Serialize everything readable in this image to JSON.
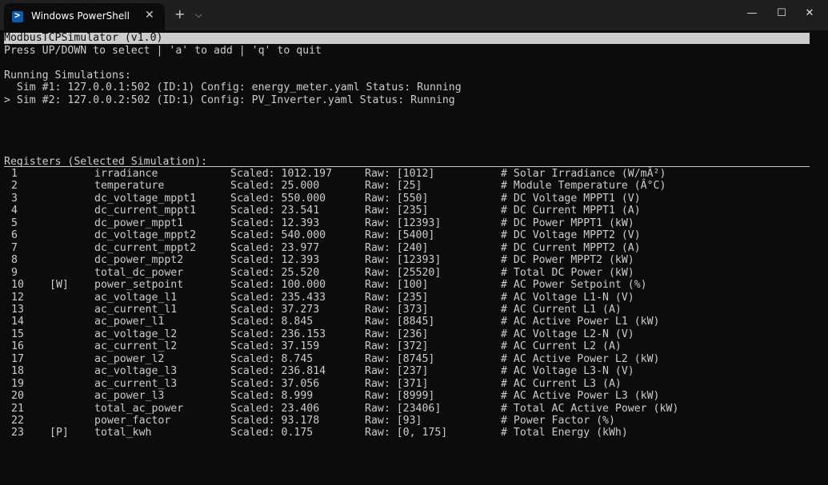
{
  "window": {
    "tab_title": "Windows PowerShell",
    "tab_close": "✕",
    "new_tab": "+",
    "dropdown": "⌵",
    "minimize": "—",
    "maximize": "☐",
    "close": "✕"
  },
  "terminal": {
    "header": "ModbusTCPSimulator (v1.0)",
    "help": "Press UP/DOWN to select | 'a' to add | 'q' to quit",
    "running_title": "Running Simulations:",
    "sims": [
      "  Sim #1: 127.0.0.1:502 (ID:1) Config: energy_meter.yaml Status: Running",
      "> Sim #2: 127.0.0.2:502 (ID:1) Config: PV_Inverter.yaml Status: Running"
    ],
    "registers_title": "Registers (Selected Simulation):",
    "registers": [
      {
        "num": "1",
        "flag": "",
        "name": "irradiance",
        "scaled": "Scaled: 1012.197",
        "raw": "Raw: [1012]",
        "comment": "# Solar Irradiance (W/mÂ²)"
      },
      {
        "num": "2",
        "flag": "",
        "name": "temperature",
        "scaled": "Scaled: 25.000",
        "raw": "Raw: [25]",
        "comment": "# Module Temperature (Â°C)"
      },
      {
        "num": "3",
        "flag": "",
        "name": "dc_voltage_mppt1",
        "scaled": "Scaled: 550.000",
        "raw": "Raw: [550]",
        "comment": "# DC Voltage MPPT1 (V)"
      },
      {
        "num": "4",
        "flag": "",
        "name": "dc_current_mppt1",
        "scaled": "Scaled: 23.541",
        "raw": "Raw: [235]",
        "comment": "# DC Current MPPT1 (A)"
      },
      {
        "num": "5",
        "flag": "",
        "name": "dc_power_mppt1",
        "scaled": "Scaled: 12.393",
        "raw": "Raw: [12393]",
        "comment": "# DC Power MPPT1 (kW)"
      },
      {
        "num": "6",
        "flag": "",
        "name": "dc_voltage_mppt2",
        "scaled": "Scaled: 540.000",
        "raw": "Raw: [5400]",
        "comment": "# DC Voltage MPPT2 (V)"
      },
      {
        "num": "7",
        "flag": "",
        "name": "dc_current_mppt2",
        "scaled": "Scaled: 23.977",
        "raw": "Raw: [240]",
        "comment": "# DC Current MPPT2 (A)"
      },
      {
        "num": "8",
        "flag": "",
        "name": "dc_power_mppt2",
        "scaled": "Scaled: 12.393",
        "raw": "Raw: [12393]",
        "comment": "# DC Power MPPT2 (kW)"
      },
      {
        "num": "9",
        "flag": "",
        "name": "total_dc_power",
        "scaled": "Scaled: 25.520",
        "raw": "Raw: [25520]",
        "comment": "# Total DC Power (kW)"
      },
      {
        "num": "10",
        "flag": "[W]",
        "name": "power_setpoint",
        "scaled": "Scaled: 100.000",
        "raw": "Raw: [100]",
        "comment": "# AC Power Setpoint (%)"
      },
      {
        "num": "12",
        "flag": "",
        "name": "ac_voltage_l1",
        "scaled": "Scaled: 235.433",
        "raw": "Raw: [235]",
        "comment": "# AC Voltage L1-N (V)"
      },
      {
        "num": "13",
        "flag": "",
        "name": "ac_current_l1",
        "scaled": "Scaled: 37.273",
        "raw": "Raw: [373]",
        "comment": "# AC Current L1 (A)"
      },
      {
        "num": "14",
        "flag": "",
        "name": "ac_power_l1",
        "scaled": "Scaled: 8.845",
        "raw": "Raw: [8845]",
        "comment": "# AC Active Power L1 (kW)"
      },
      {
        "num": "15",
        "flag": "",
        "name": "ac_voltage_l2",
        "scaled": "Scaled: 236.153",
        "raw": "Raw: [236]",
        "comment": "# AC Voltage L2-N (V)"
      },
      {
        "num": "16",
        "flag": "",
        "name": "ac_current_l2",
        "scaled": "Scaled: 37.159",
        "raw": "Raw: [372]",
        "comment": "# AC Current L2 (A)"
      },
      {
        "num": "17",
        "flag": "",
        "name": "ac_power_l2",
        "scaled": "Scaled: 8.745",
        "raw": "Raw: [8745]",
        "comment": "# AC Active Power L2 (kW)"
      },
      {
        "num": "18",
        "flag": "",
        "name": "ac_voltage_l3",
        "scaled": "Scaled: 236.814",
        "raw": "Raw: [237]",
        "comment": "# AC Voltage L3-N (V)"
      },
      {
        "num": "19",
        "flag": "",
        "name": "ac_current_l3",
        "scaled": "Scaled: 37.056",
        "raw": "Raw: [371]",
        "comment": "# AC Current L3 (A)"
      },
      {
        "num": "20",
        "flag": "",
        "name": "ac_power_l3",
        "scaled": "Scaled: 8.999",
        "raw": "Raw: [8999]",
        "comment": "# AC Active Power L3 (kW)"
      },
      {
        "num": "21",
        "flag": "",
        "name": "total_ac_power",
        "scaled": "Scaled: 23.406",
        "raw": "Raw: [23406]",
        "comment": "# Total AC Active Power (kW)"
      },
      {
        "num": "22",
        "flag": "",
        "name": "power_factor",
        "scaled": "Scaled: 93.178",
        "raw": "Raw: [93]",
        "comment": "# Power Factor (%)"
      },
      {
        "num": "23",
        "flag": "[P]",
        "name": "total_kwh",
        "scaled": "Scaled: 0.175",
        "raw": "Raw: [0, 175]",
        "comment": "# Total Energy (kWh)"
      }
    ]
  }
}
